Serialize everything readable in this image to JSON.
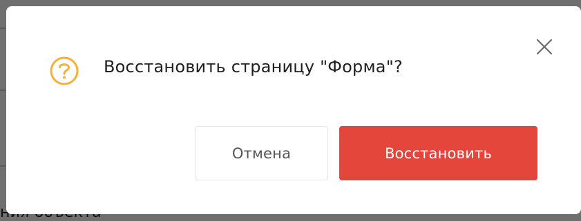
{
  "backdrop": {
    "partial_text": "ния объекта"
  },
  "dialog": {
    "title": "Восстановить страницу \"Форма\"?",
    "icon": "question-circle-icon",
    "close_icon": "close-icon",
    "buttons": {
      "cancel_label": "Отмена",
      "confirm_label": "Восстановить"
    }
  },
  "colors": {
    "accent_warning": "#F5B135",
    "primary_danger": "#E5463B",
    "overlay": "#6F6F6F"
  }
}
